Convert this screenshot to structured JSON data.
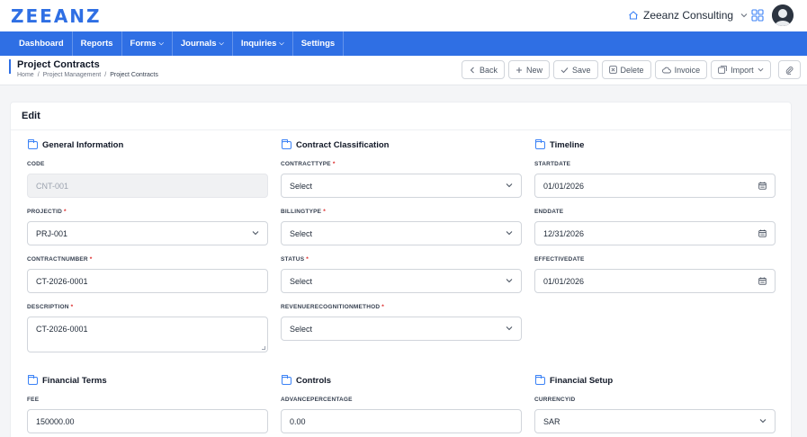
{
  "app": {
    "logo": "ZEEANZ",
    "company": "Zeeanz Consulting"
  },
  "nav": [
    {
      "label": "Dashboard",
      "has_menu": false
    },
    {
      "label": "Reports",
      "has_menu": false
    },
    {
      "label": "Forms",
      "has_menu": true
    },
    {
      "label": "Journals",
      "has_menu": true
    },
    {
      "label": "Inquiries",
      "has_menu": true
    },
    {
      "label": "Settings",
      "has_menu": false
    }
  ],
  "header": {
    "title": "Project Contracts",
    "breadcrumb": [
      "Home",
      "/",
      "Project Management",
      "/",
      "Project Contracts"
    ],
    "actions": {
      "back": "Back",
      "new": "New",
      "save": "Save",
      "delete": "Delete",
      "invoice": "Invoice",
      "import": "Import"
    }
  },
  "card": {
    "title": "Edit"
  },
  "sections": {
    "general": "General Information",
    "classification": "Contract Classification",
    "timeline": "Timeline",
    "financial_terms": "Financial Terms",
    "controls": "Controls",
    "financial_setup": "Financial Setup"
  },
  "fields": {
    "code": {
      "label": "CODE",
      "value": "CNT-001"
    },
    "projectid": {
      "label": "PROJECTID",
      "value": "PRJ-001"
    },
    "contractnumber": {
      "label": "CONTRACTNUMBER",
      "value": "CT-2026-0001"
    },
    "description": {
      "label": "DESCRIPTION",
      "value": "CT-2026-0001"
    },
    "contracttype": {
      "label": "CONTRACTTYPE",
      "value": "Select"
    },
    "billingtype": {
      "label": "BILLINGTYPE",
      "value": "Select"
    },
    "status": {
      "label": "STATUS",
      "value": "Select"
    },
    "revenuerecognitionmethod": {
      "label": "REVENUERECOGNITIONMETHOD",
      "value": "Select"
    },
    "startdate": {
      "label": "STARTDATE",
      "value": "01/01/2026"
    },
    "enddate": {
      "label": "ENDDATE",
      "value": "12/31/2026"
    },
    "effectivedate": {
      "label": "EFFECTIVEDATE",
      "value": "01/01/2026"
    },
    "fee": {
      "label": "FEE",
      "value": "150000.00"
    },
    "advancepercentage": {
      "label": "ADVANCEPERCENTAGE",
      "value": "0.00"
    },
    "currencyid": {
      "label": "CURRENCYID",
      "value": "SAR"
    }
  },
  "colors": {
    "brand": "#2f6fe4",
    "required": "#dc2626"
  }
}
